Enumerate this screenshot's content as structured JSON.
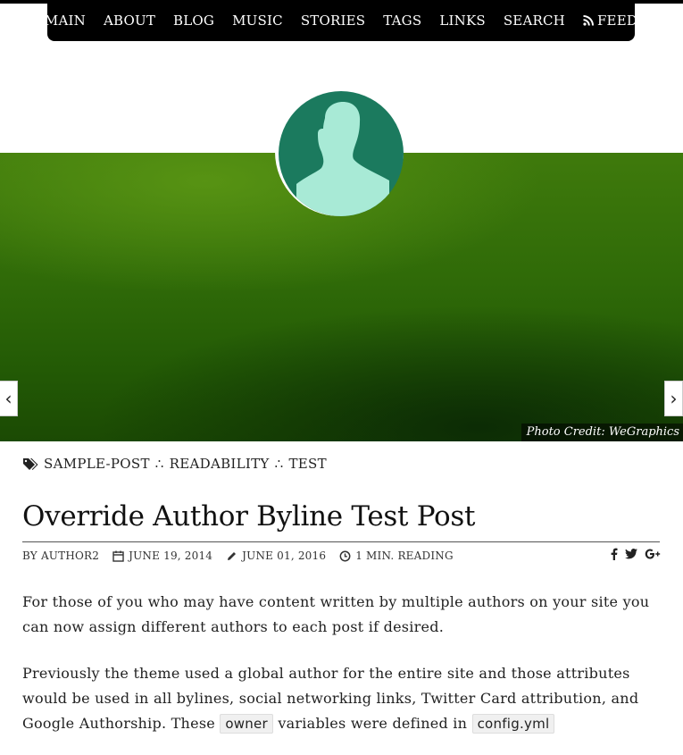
{
  "nav": {
    "items": [
      {
        "label": "MAIN"
      },
      {
        "label": "ABOUT"
      },
      {
        "label": "BLOG"
      },
      {
        "label": "MUSIC"
      },
      {
        "label": "STORIES"
      },
      {
        "label": "TAGS"
      },
      {
        "label": "LINKS"
      },
      {
        "label": "SEARCH"
      },
      {
        "label": "FEED",
        "icon": "rss-icon"
      }
    ]
  },
  "hero": {
    "credit_prefix": "Photo Credit:",
    "credit_name": "WeGraphics",
    "colors": {
      "green_top": "#3f7a0c",
      "green_bottom": "#1b4a04",
      "avatar_bg": "#1b7a5e",
      "avatar_fg": "#a8ead6"
    }
  },
  "post": {
    "tags": [
      "SAMPLE-POST",
      "READABILITY",
      "TEST"
    ],
    "tag_separator": "∴",
    "title": "Override Author Byline Test Post",
    "byline": "BY AUTHOR2",
    "published": "JUNE 19, 2014",
    "updated": "JUNE 01, 2016",
    "reading": "1 MIN. READING",
    "social": [
      "facebook-icon",
      "twitter-icon",
      "google-plus-icon"
    ],
    "paragraph1": "For those of you who may have content written by multiple authors on your site you can now assign different authors to each post if desired.",
    "paragraph2_a": "Previously the theme used a global author for the entire site and those attributes would be used in all bylines, social networking links, Twitter Card attribution, and Google Authorship. These",
    "code1": "owner",
    "paragraph2_b": "variables were defined in",
    "code2": "config.yml"
  }
}
